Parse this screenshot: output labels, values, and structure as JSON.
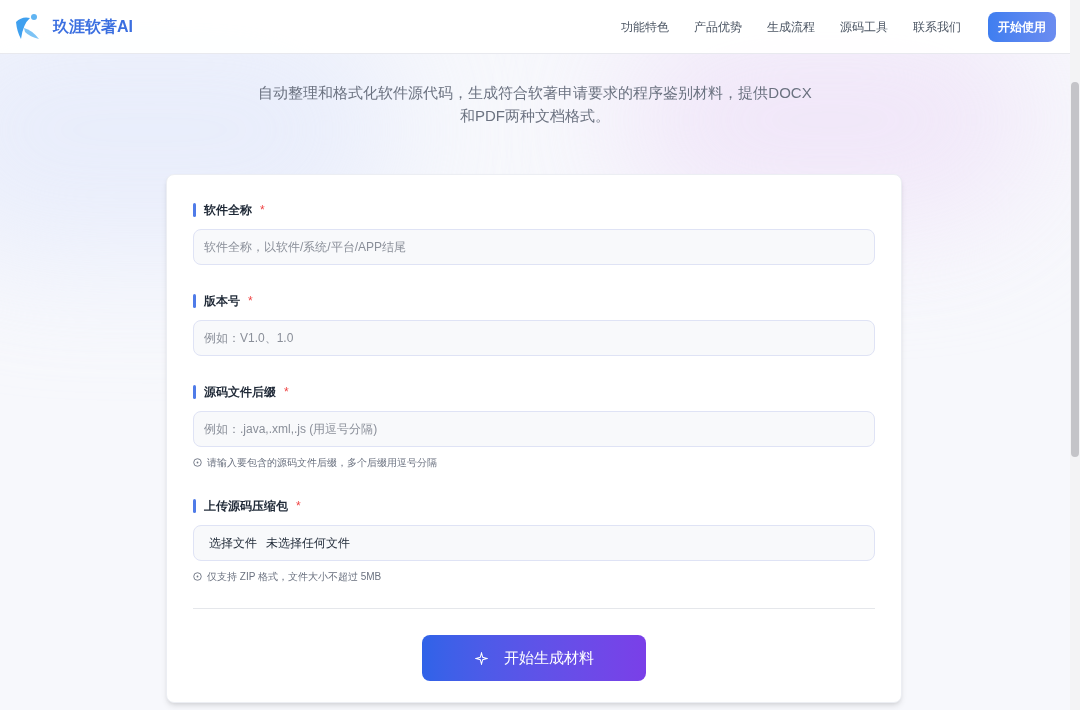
{
  "header": {
    "brand": "玖涯软著AI",
    "nav": [
      {
        "label": "功能特色"
      },
      {
        "label": "产品优势"
      },
      {
        "label": "生成流程"
      },
      {
        "label": "源码工具"
      },
      {
        "label": "联系我们"
      }
    ],
    "cta": "开始使用"
  },
  "subtitle": "自动整理和格式化软件源代码，生成符合软著申请要求的程序鉴别材料，提供DOCX和PDF两种文档格式。",
  "form": {
    "fields": [
      {
        "kind": "text",
        "label": "软件全称",
        "required_mark": "*",
        "placeholder": "软件全称，以软件/系统/平台/APP结尾"
      },
      {
        "kind": "text",
        "label": "版本号",
        "required_mark": "*",
        "placeholder": "例如：V1.0、1.0"
      },
      {
        "kind": "text",
        "label": "源码文件后缀",
        "required_mark": "*",
        "placeholder": "例如：.java,.xml,.js (用逗号分隔)",
        "hint": "请输入要包含的源码文件后缀，多个后缀用逗号分隔"
      },
      {
        "kind": "file",
        "label": "上传源码压缩包",
        "required_mark": "*",
        "button": "选择文件",
        "status": "未选择任何文件",
        "hint": "仅支持 ZIP 格式，文件大小不超过 5MB"
      }
    ],
    "submit": "开始生成材料"
  }
}
